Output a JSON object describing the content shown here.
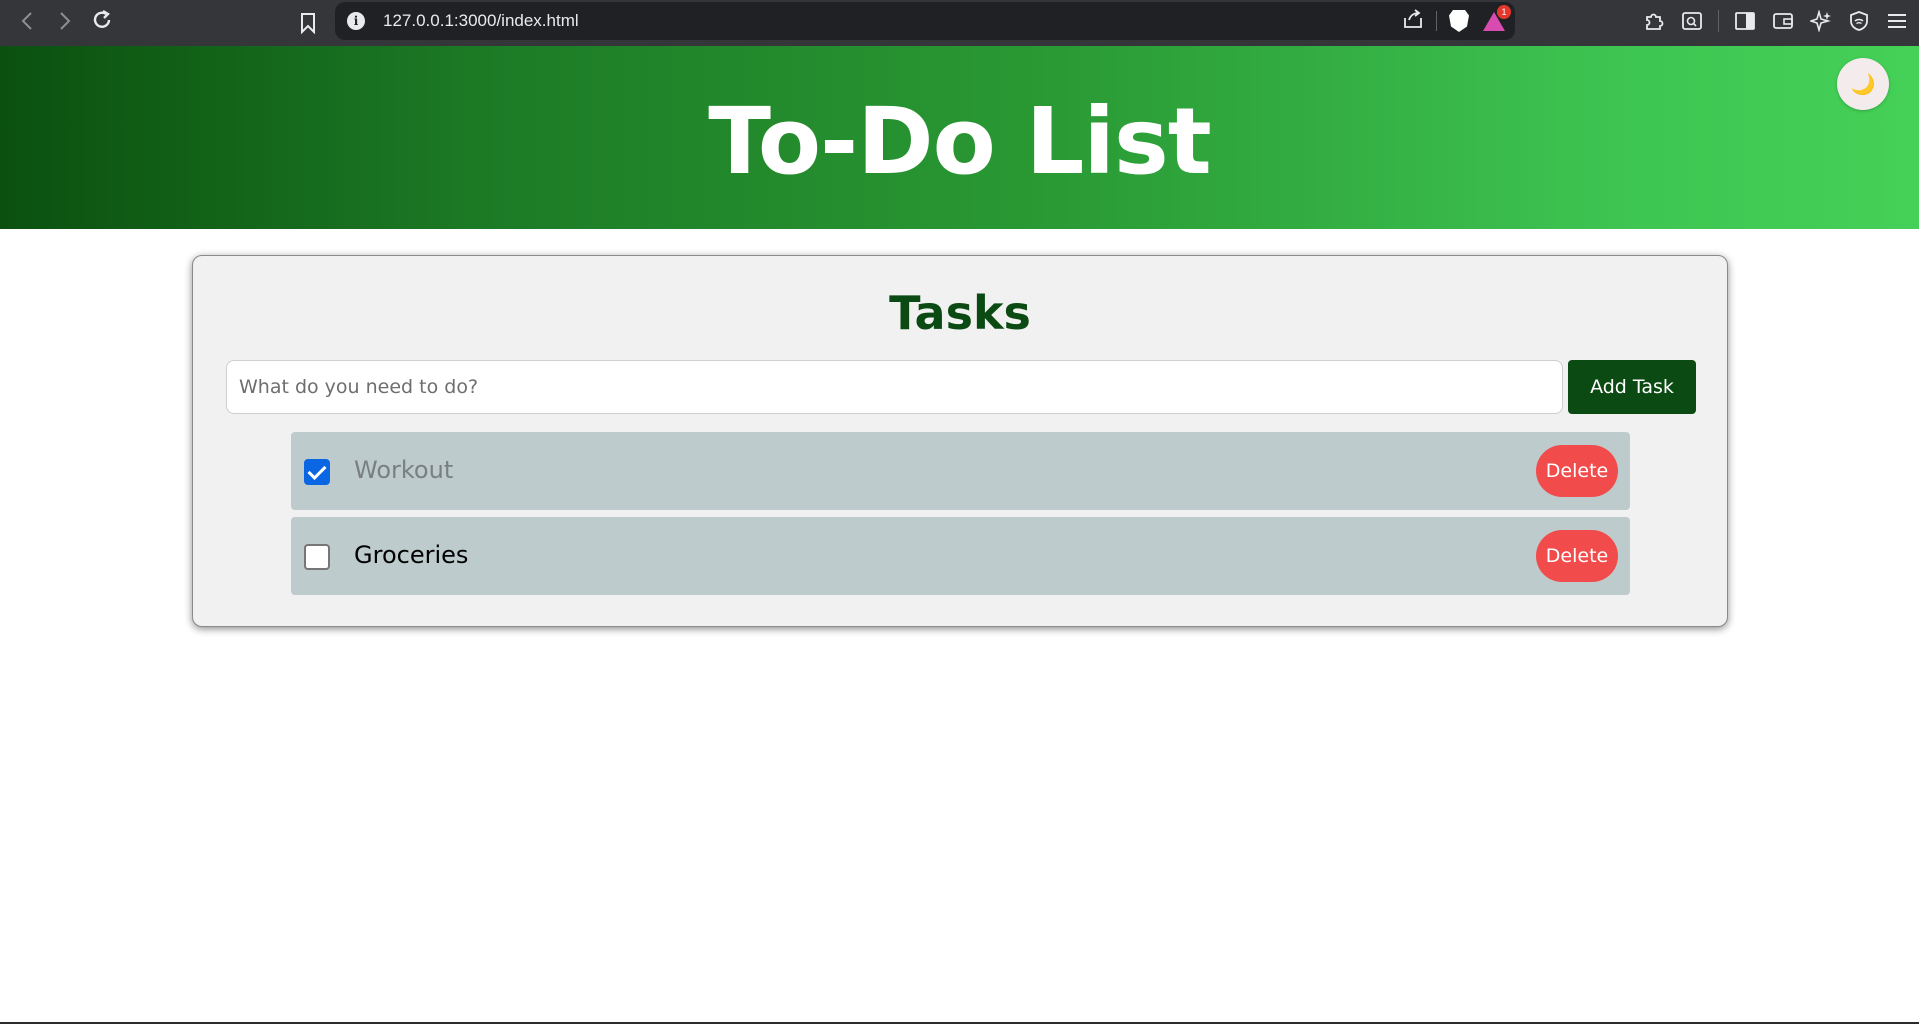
{
  "browser": {
    "url": "127.0.0.1:3000/index.html",
    "notification_count": "1"
  },
  "header": {
    "title": "To-Do List",
    "theme_toggle_icon": "🌙"
  },
  "tasks_card": {
    "title": "Tasks",
    "input_placeholder": "What do you need to do?",
    "input_value": "",
    "add_label": "Add Task",
    "items": [
      {
        "text": "Workout",
        "done": true,
        "delete_label": "Delete"
      },
      {
        "text": "Groceries",
        "done": false,
        "delete_label": "Delete"
      }
    ]
  },
  "colors": {
    "header_gradient_start": "#0b500f",
    "header_gradient_end": "#45d057",
    "primary_dark_green": "#0b4a12",
    "task_bg": "#bdcbcc",
    "delete_red": "#f24b4b",
    "checkbox_blue": "#0b66e4"
  }
}
